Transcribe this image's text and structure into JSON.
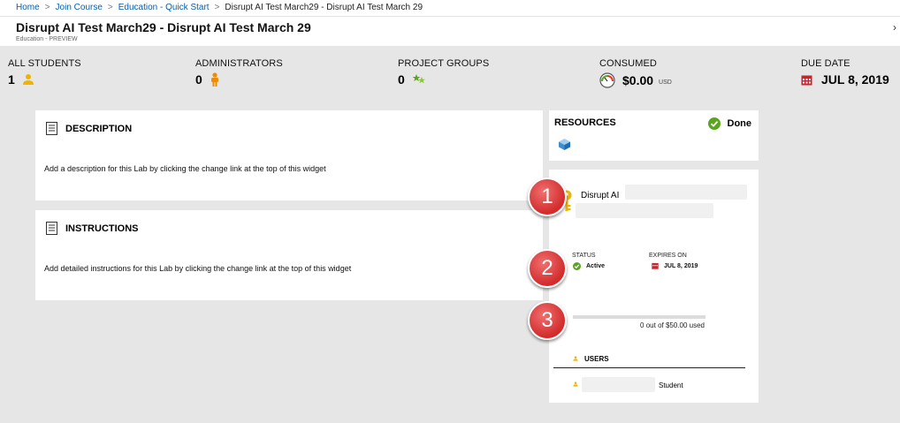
{
  "breadcrumb": {
    "items": [
      "Home",
      "Join Course",
      "Education - Quick Start"
    ],
    "current": "Disrupt AI Test March29 - Disrupt AI Test March 29"
  },
  "header": {
    "title": "Disrupt AI Test March29 - Disrupt AI Test March 29",
    "subtitle": "Education - PREVIEW"
  },
  "stats": {
    "all_students": {
      "label": "ALL STUDENTS",
      "value": "1"
    },
    "administrators": {
      "label": "ADMINISTRATORS",
      "value": "0"
    },
    "project_groups": {
      "label": "PROJECT GROUPS",
      "value": "0"
    },
    "consumed": {
      "label": "CONSUMED",
      "value": "$0.00",
      "unit": "USD"
    },
    "due_date": {
      "label": "DUE DATE",
      "value": "JUL 8, 2019"
    }
  },
  "description": {
    "title": "DESCRIPTION",
    "body": "Add a description for this Lab by clicking the change link at the top of this widget"
  },
  "instructions": {
    "title": "INSTRUCTIONS",
    "body": "Add detailed instructions for this Lab by clicking the change link at the top of this widget"
  },
  "resources": {
    "title": "RESOURCES",
    "status": "Done"
  },
  "subscription": {
    "name": "Disrupt AI",
    "status_label": "STATUS",
    "status_value": "Active",
    "expires_label": "EXPIRES ON",
    "expires_value": "JUL 8, 2019",
    "usage_text": "0 out of $50.00 used",
    "usage_fraction": 0,
    "users_title": "USERS",
    "user_role": "Student"
  },
  "callouts": [
    "1",
    "2",
    "3"
  ],
  "colors": {
    "link": "#0060b0",
    "ok_green": "#5aa51e",
    "calendar_red": "#c4262e",
    "callout_red": "#d22b2b",
    "person_yellow": "#f0b400",
    "admin_orange": "#f08a00"
  }
}
